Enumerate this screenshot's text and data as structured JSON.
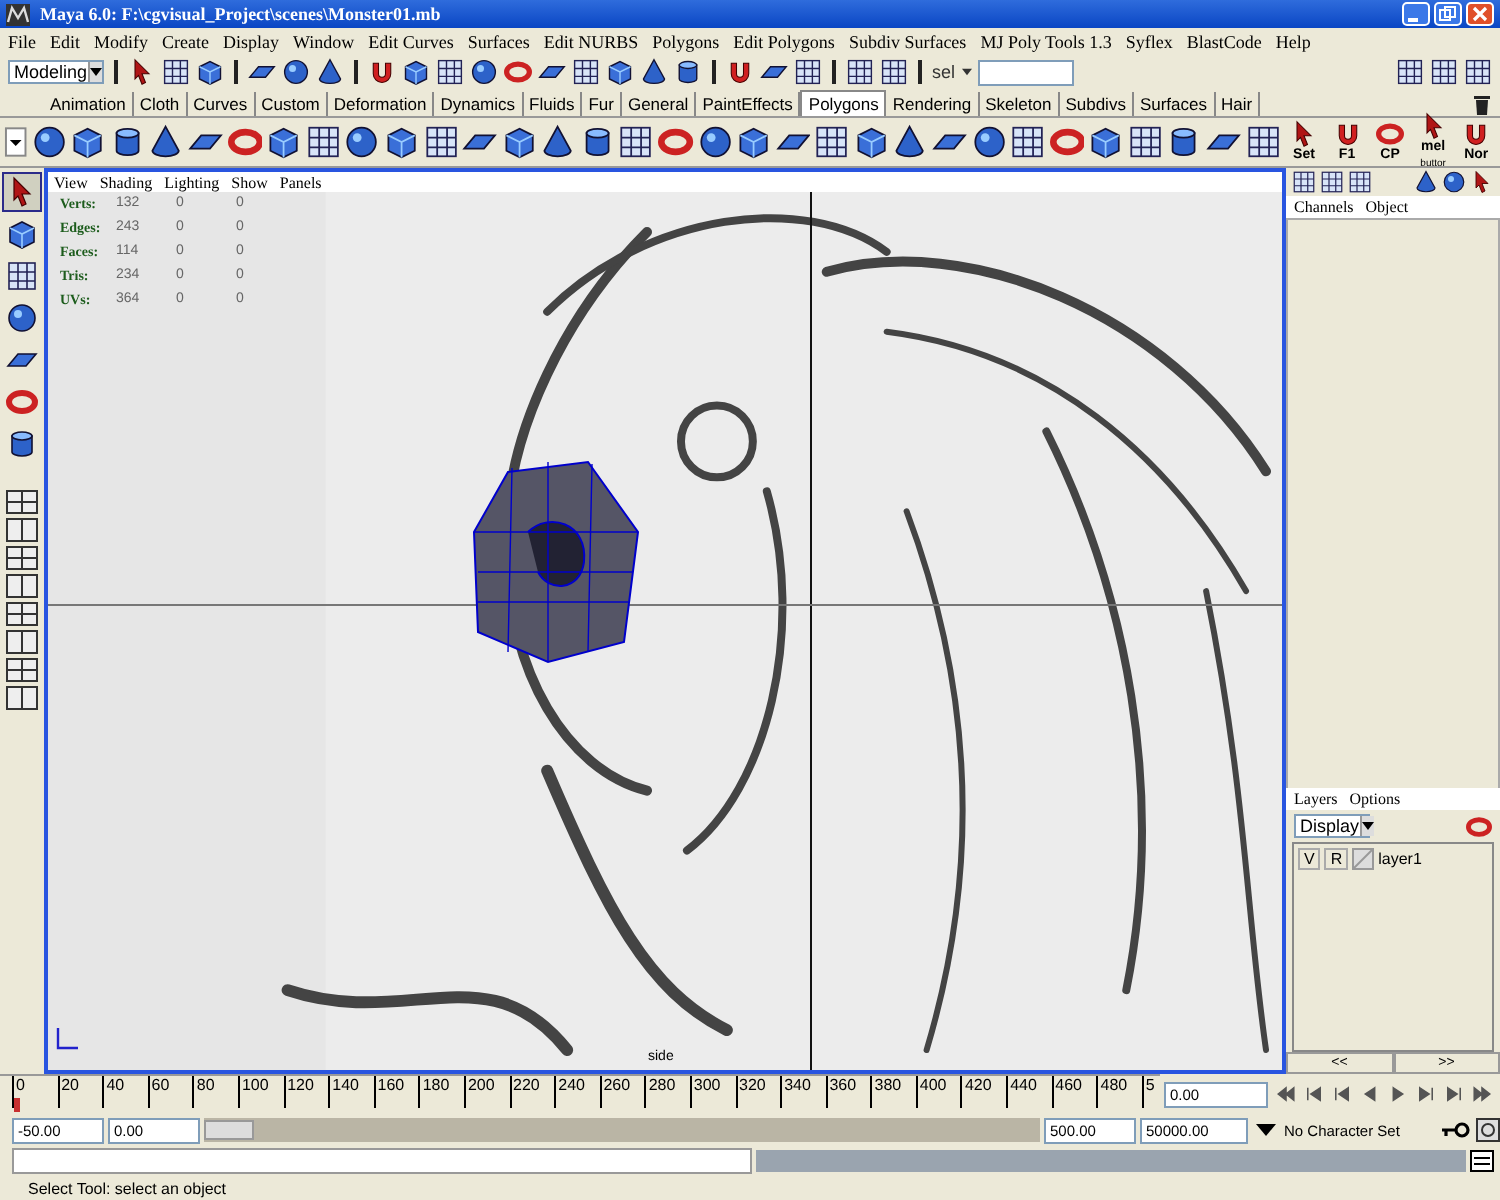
{
  "window": {
    "title": "Maya 6.0: F:\\cgvisual_Project\\scenes\\Monster01.mb"
  },
  "menu_bar": [
    "File",
    "Edit",
    "Modify",
    "Create",
    "Display",
    "Window",
    "Edit Curves",
    "Surfaces",
    "Edit NURBS",
    "Polygons",
    "Edit Polygons",
    "Subdiv Surfaces",
    "MJ Poly Tools 1.3",
    "Syflex",
    "BlastCode",
    "Help"
  ],
  "toolbar": {
    "mode": "Modeling",
    "selection_label": "sel"
  },
  "shelf_tabs": [
    {
      "label": "Animation",
      "selected": false
    },
    {
      "label": "Cloth",
      "selected": false
    },
    {
      "label": "Curves",
      "selected": false
    },
    {
      "label": "Custom",
      "selected": false
    },
    {
      "label": "Deformation",
      "selected": false
    },
    {
      "label": "Dynamics",
      "selected": false
    },
    {
      "label": "Fluids",
      "selected": false
    },
    {
      "label": "Fur",
      "selected": false
    },
    {
      "label": "General",
      "selected": false
    },
    {
      "label": "PaintEffects",
      "selected": false
    },
    {
      "label": "Polygons",
      "selected": true
    },
    {
      "label": "Rendering",
      "selected": false
    },
    {
      "label": "Skeleton",
      "selected": false
    },
    {
      "label": "Subdivs",
      "selected": false
    },
    {
      "label": "Surfaces",
      "selected": false
    },
    {
      "label": "Hair",
      "selected": false
    }
  ],
  "shelf_text_buttons": [
    {
      "label": "Set"
    },
    {
      "label": "F1"
    },
    {
      "label": "CP"
    },
    {
      "label": "mel",
      "sublabel": "buttor"
    },
    {
      "label": "Nor"
    }
  ],
  "toolbox": [
    {
      "selected": true
    },
    {
      "selected": false
    },
    {
      "selected": false
    },
    {
      "selected": false
    },
    {
      "selected": false
    },
    {
      "selected": false
    },
    {
      "selected": false
    }
  ],
  "viewport": {
    "menus": [
      "View",
      "Shading",
      "Lighting",
      "Show",
      "Panels"
    ],
    "hud": [
      {
        "label": "Verts:",
        "values": [
          "132",
          "0",
          "0"
        ]
      },
      {
        "label": "Edges:",
        "values": [
          "243",
          "0",
          "0"
        ]
      },
      {
        "label": "Faces:",
        "values": [
          "114",
          "0",
          "0"
        ]
      },
      {
        "label": "Tris:",
        "values": [
          "234",
          "0",
          "0"
        ]
      },
      {
        "label": "UVs:",
        "values": [
          "364",
          "0",
          "0"
        ]
      }
    ],
    "camera_label": "side"
  },
  "channel_box": {
    "menus": [
      "Channels",
      "Object"
    ]
  },
  "layer_editor": {
    "menus": [
      "Layers",
      "Options"
    ],
    "display": "Display",
    "layers": [
      {
        "v": "V",
        "r": "R",
        "name": "layer1"
      }
    ],
    "nav": [
      "<<",
      ">>"
    ]
  },
  "timeline": {
    "ticks": [
      "0",
      "20",
      "40",
      "60",
      "80",
      "100",
      "120",
      "140",
      "160",
      "180",
      "200",
      "220",
      "240",
      "260",
      "280",
      "300",
      "320",
      "340",
      "360",
      "380",
      "400",
      "420",
      "440",
      "460",
      "480",
      "5"
    ],
    "current_time": "0.00",
    "level": 0
  },
  "range": {
    "start": "-50.00",
    "playback_start": "0.00",
    "playback_end": "500.00",
    "end": "50000.00",
    "character_set": "No Character Set",
    "level": 0.06
  },
  "help_line": "Select Tool: select an object"
}
